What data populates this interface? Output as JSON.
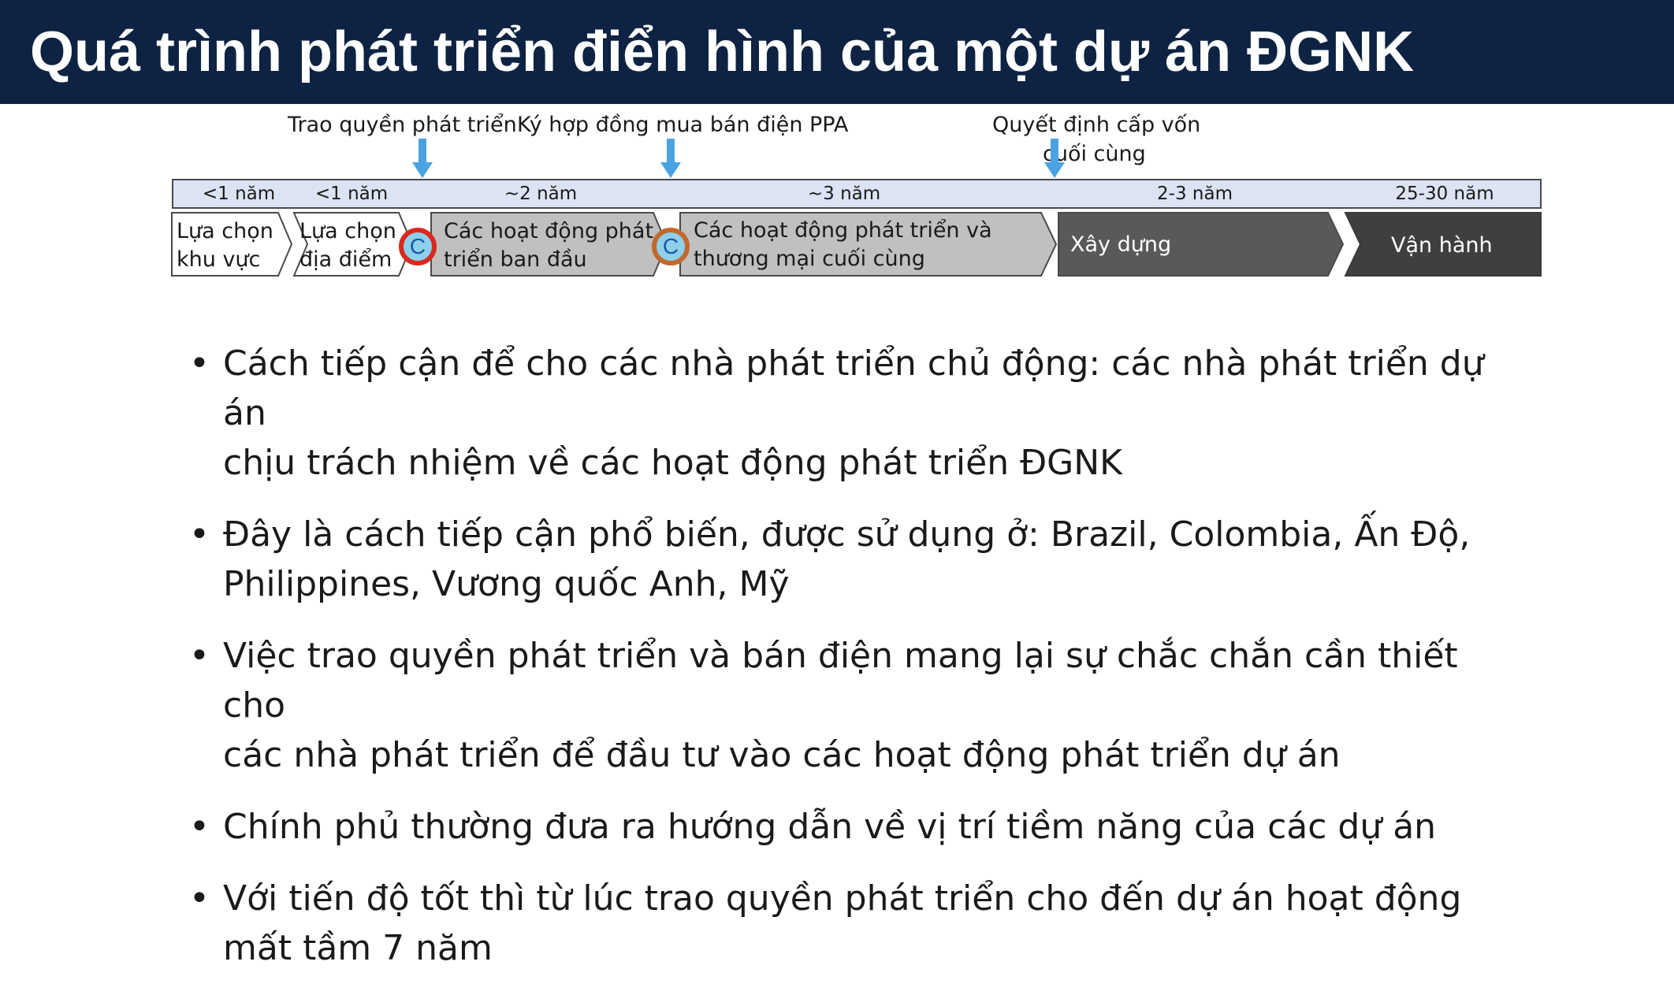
{
  "title": "Quá trình phát triển điển hình của một dự án ĐGNK",
  "milestones": [
    {
      "label": "Trao quyền phát triển"
    },
    {
      "label": "Ký hợp đồng mua bán điện PPA"
    },
    {
      "label_line1": "Quyết định cấp vốn",
      "label_line2": "cuối cùng"
    }
  ],
  "durations": [
    "<1 năm",
    "<1 năm",
    "~2 năm",
    "~3 năm",
    "2-3 năm",
    "25-30 năm"
  ],
  "phases": [
    {
      "line1": "Lựa chọn",
      "line2": "khu vực"
    },
    {
      "line1": "Lựa chọn",
      "line2": "địa điểm"
    },
    {
      "line1": "Các hoạt động phát",
      "line2": "triển ban đầu"
    },
    {
      "line1": "Các hoạt động phát triển và",
      "line2": "thương mại cuối cùng"
    },
    {
      "label": "Xây dựng"
    },
    {
      "label": "Vận hành"
    }
  ],
  "badges": [
    {
      "letter": "C",
      "ring_color": "#d9281e"
    },
    {
      "letter": "C",
      "ring_color": "#c0692e"
    }
  ],
  "colors": {
    "title_bg": "#0e2343",
    "arrow": "#4aa3e0",
    "duration_bar": "#dce3f3",
    "phase_white": "#ffffff",
    "phase_light_gray": "#c0c0c0",
    "phase_dark_gray": "#595959",
    "phase_darkest": "#3f3f3f"
  },
  "bullets": [
    {
      "line1": "Cách tiếp cận để cho các nhà phát triển chủ động: các nhà phát triển dự án",
      "line2": "chịu trách nhiệm về các hoạt động phát triển ĐGNK"
    },
    {
      "line1": "Đây là cách tiếp cận phổ biến, được sử dụng ở: Brazil, Colombia, Ấn Độ,",
      "line2": "Philippines, Vương quốc Anh, Mỹ"
    },
    {
      "line1": "Việc trao quyền phát triển và bán điện mang lại sự chắc chắn cần thiết cho",
      "line2": "các nhà phát triển để đầu tư vào các hoạt động phát triển dự án"
    },
    {
      "line1": "Chính phủ thường đưa ra hướng dẫn về vị trí tiềm năng của các dự án"
    },
    {
      "line1": "Với tiến độ tốt thì từ lúc trao quyền phát triển cho đến dự án hoạt động",
      "line2": "mất tầm 7 năm"
    }
  ],
  "bullet_symbol": "•"
}
